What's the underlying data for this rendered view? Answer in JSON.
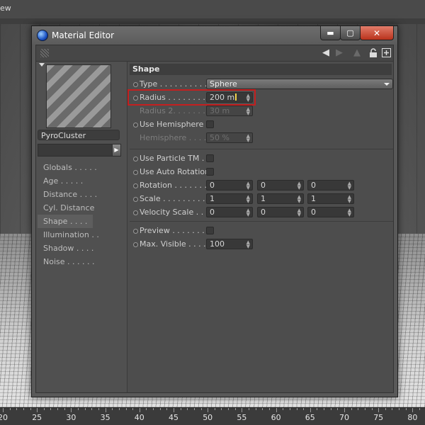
{
  "app": {
    "partial_menu_text": "ew"
  },
  "window": {
    "title": "Material Editor",
    "minimize": "▬",
    "maximize": "▢",
    "close": "✕"
  },
  "toolbar": {
    "back_icon": "◀",
    "forward_icon": "▶",
    "up_icon": "▲",
    "lock_icon": "🔓",
    "new_icon": "⊞"
  },
  "material": {
    "name": "PyroCluster",
    "channel_value": ""
  },
  "nav": {
    "items": [
      "Globals . . . . .",
      "Age . . . . .",
      "Distance . . . .",
      "Cyl. Distance",
      "Shape . . . .",
      "Illumination . .",
      "Shadow . . . .",
      "Noise . . . . . ."
    ],
    "active": "Shape . . . ."
  },
  "shape": {
    "header": "Shape",
    "type_label": "Type . . . . . . . . . . .",
    "type_value": "Sphere",
    "radius_label": "Radius . . . . . . . . .",
    "radius_value": "200 m",
    "radius2_label": "Radius 2. . . . . . . .",
    "radius2_value": "30 m",
    "use_hemisphere_label": "Use Hemisphere",
    "hemisphere_label": "Hemisphere . . . . .",
    "hemisphere_value": "50 %",
    "use_particle_tm_label": "Use Particle TM . .",
    "use_auto_rotation_label": "Use Auto Rotation",
    "rotation_label": "Rotation . . . . . . . .",
    "rotation": [
      "0",
      "0",
      "0"
    ],
    "scale_label": "Scale . . . . . . . . . .",
    "scale": [
      "1",
      "1",
      "1"
    ],
    "velocity_scale_label": "Velocity Scale . . .",
    "velocity_scale": [
      "0",
      "0",
      "0"
    ],
    "preview_label": "Preview . . . . . . . .",
    "max_visible_label": "Max. Visible . . . . .",
    "max_visible_value": "100"
  },
  "ruler": {
    "labels": [
      "20",
      "25",
      "30",
      "35",
      "40",
      "45",
      "50",
      "55",
      "60",
      "65",
      "70",
      "75",
      "80"
    ]
  },
  "colors": {
    "highlight": "#c41f1f",
    "close_button": "#c9452d"
  }
}
